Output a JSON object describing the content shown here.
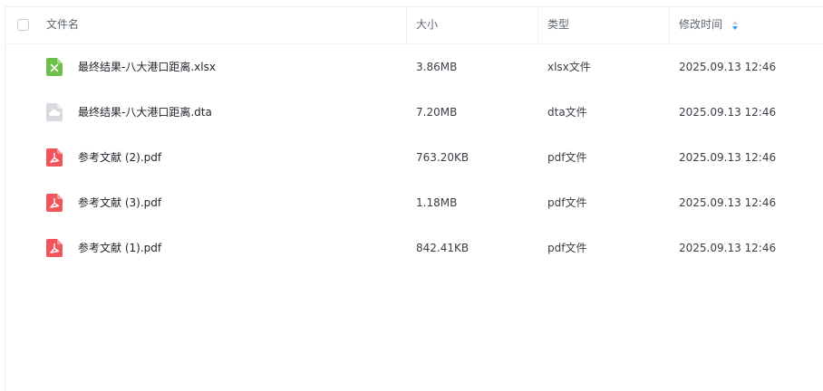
{
  "header": {
    "name_label": "文件名",
    "size_label": "大小",
    "type_label": "类型",
    "time_label": "修改时间"
  },
  "files": [
    {
      "name": "最终结果-八大港口距离.xlsx",
      "size": "3.86MB",
      "type": "xlsx文件",
      "modified": "2025.09.13 12:46",
      "icon": "excel-file-icon"
    },
    {
      "name": "最终结果-八大港口距离.dta",
      "size": "7.20MB",
      "type": "dta文件",
      "modified": "2025.09.13 12:46",
      "icon": "generic-file-icon"
    },
    {
      "name": "参考文献 (2).pdf",
      "size": "763.20KB",
      "type": "pdf文件",
      "modified": "2025.09.13 12:46",
      "icon": "pdf-file-icon"
    },
    {
      "name": "参考文献 (3).pdf",
      "size": "1.18MB",
      "type": "pdf文件",
      "modified": "2025.09.13 12:46",
      "icon": "pdf-file-icon"
    },
    {
      "name": "参考文献 (1).pdf",
      "size": "842.41KB",
      "type": "pdf文件",
      "modified": "2025.09.13 12:46",
      "icon": "pdf-file-icon"
    }
  ],
  "colors": {
    "excel": "#6cc04a",
    "pdf": "#f2545b",
    "generic": "#d7dbe0",
    "sort_accent": "#2f9bff"
  }
}
